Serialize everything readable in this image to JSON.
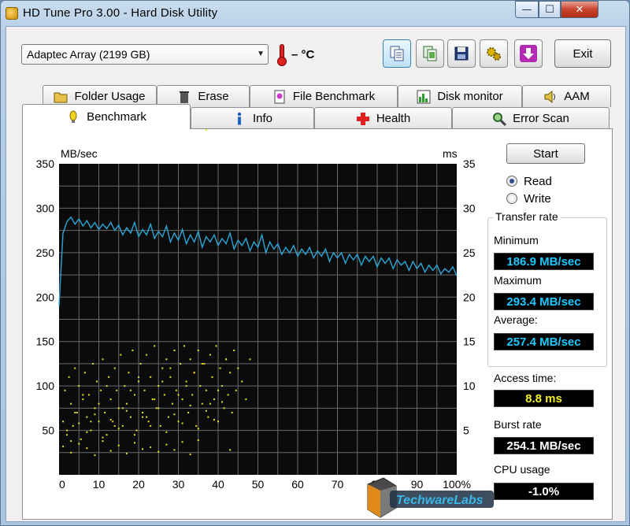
{
  "window": {
    "title": "HD Tune Pro 3.00 - Hard Disk Utility",
    "caption_buttons": {
      "minimize": "—",
      "maximize": "☐",
      "close": "✕"
    }
  },
  "toolbar": {
    "drive": "Adaptec Array (2199 GB)",
    "temperature": "– °C",
    "exit_label": "Exit"
  },
  "tabs_top": [
    "Folder Usage",
    "Erase",
    "File Benchmark",
    "Disk monitor",
    "AAM"
  ],
  "tabs_bottom": [
    "Benchmark",
    "Info",
    "Health",
    "Error Scan"
  ],
  "benchmark": {
    "start_label": "Start",
    "read_label": "Read",
    "write_label": "Write",
    "selected_mode": "Read",
    "transfer_rate_label": "Transfer rate",
    "minimum_label": "Minimum",
    "minimum_value": "186.9 MB/sec",
    "maximum_label": "Maximum",
    "maximum_value": "293.4 MB/sec",
    "average_label": "Average:",
    "average_value": "257.4 MB/sec",
    "access_time_label": "Access time:",
    "access_time_value": "8.8 ms",
    "burst_rate_label": "Burst rate",
    "burst_rate_value": "254.1 MB/sec",
    "cpu_usage_label": "CPU usage",
    "cpu_usage_value": "-1.0%"
  },
  "chart_data": {
    "type": "line",
    "left_axis_label": "MB/sec",
    "right_axis_label": "ms",
    "y_left_ticks": [
      50,
      100,
      150,
      200,
      250,
      300,
      350
    ],
    "y_right_ticks": [
      5,
      10,
      15,
      20,
      25,
      30,
      35
    ],
    "x_ticks": [
      "0",
      "10",
      "20",
      "30",
      "40",
      "50",
      "60",
      "70",
      "80",
      "90",
      "100%"
    ],
    "ylim_left": [
      0,
      350
    ],
    "ylim_right": [
      0,
      35
    ],
    "xlim": [
      0,
      100
    ],
    "grid": true,
    "series": [
      {
        "x": [
          0,
          0.5,
          1,
          2,
          3,
          4,
          5,
          6,
          7,
          8,
          9,
          10,
          11,
          12,
          13,
          14,
          15,
          16,
          17,
          18,
          19,
          20,
          21,
          22,
          23,
          24,
          25,
          26,
          27,
          28,
          29,
          30,
          31,
          32,
          33,
          34,
          35,
          36,
          37,
          38,
          39,
          40,
          41,
          42,
          43,
          44,
          45,
          46,
          47,
          48,
          49,
          50,
          51,
          52,
          53,
          54,
          55,
          56,
          57,
          58,
          59,
          60,
          61,
          62,
          63,
          64,
          65,
          66,
          67,
          68,
          69,
          70,
          71,
          72,
          73,
          74,
          75,
          76,
          77,
          78,
          79,
          80,
          81,
          82,
          83,
          84,
          85,
          86,
          87,
          88,
          89,
          90,
          91,
          92,
          93,
          94,
          95,
          96,
          97,
          98,
          99,
          100
        ],
        "y": [
          190,
          232,
          272,
          285,
          290,
          282,
          288,
          280,
          286,
          278,
          284,
          276,
          282,
          277,
          284,
          275,
          281,
          270,
          278,
          272,
          284,
          268,
          276,
          270,
          282,
          266,
          274,
          268,
          280,
          262,
          272,
          264,
          276,
          260,
          270,
          262,
          274,
          256,
          268,
          262,
          270,
          258,
          266,
          260,
          272,
          254,
          264,
          258,
          266,
          252,
          262,
          256,
          270,
          250,
          262,
          254,
          260,
          248,
          256,
          250,
          258,
          246,
          254,
          248,
          256,
          244,
          252,
          246,
          254,
          240,
          250,
          244,
          250,
          238,
          248,
          242,
          248,
          236,
          246,
          240,
          246,
          234,
          244,
          238,
          244,
          232,
          242,
          236,
          240,
          230,
          240,
          232,
          238,
          228,
          236,
          230,
          236,
          226,
          232,
          228,
          234,
          224
        ]
      }
    ],
    "scatter": {
      "x": [
        1,
        1.5,
        2,
        2.5,
        3,
        3.5,
        4,
        4.5,
        5,
        5.5,
        6,
        6.5,
        7,
        7.5,
        8,
        8.5,
        9,
        9.5,
        10,
        10.5,
        11,
        11.5,
        12,
        12.5,
        13,
        13.5,
        14,
        14.5,
        15,
        15.5,
        16,
        16.5,
        17,
        17.5,
        18,
        18.5,
        19,
        19.5,
        20,
        20.5,
        21,
        21.5,
        22,
        22.5,
        23,
        23.5,
        24,
        24.5,
        25,
        25.5,
        26,
        26.5,
        27,
        27.5,
        28,
        28.5,
        29,
        29.5,
        30,
        30.5,
        31,
        31.5,
        32,
        32.5,
        33,
        33.5,
        34,
        34.5,
        35,
        35.5,
        36,
        36.5,
        37,
        37.5,
        38,
        38.5,
        39,
        39.5,
        40,
        40.5,
        41,
        41.5,
        42,
        42.5,
        43,
        43.5,
        44,
        44.5,
        45,
        46,
        47,
        48,
        2,
        4,
        6,
        8,
        10,
        12,
        14,
        16,
        18,
        20,
        22,
        24,
        26,
        28,
        30,
        32,
        34,
        36,
        38,
        40,
        42,
        3,
        5,
        7,
        9,
        11,
        13,
        15,
        17,
        19,
        21,
        23,
        25,
        27,
        29,
        31,
        33,
        35,
        37,
        39,
        41,
        43,
        1,
        3,
        5,
        7,
        9,
        11,
        13,
        15,
        17,
        19,
        21,
        23,
        25,
        27,
        29,
        31,
        33,
        35,
        37
      ],
      "y": [
        60,
        95,
        45,
        110,
        80,
        55,
        120,
        70,
        100,
        40,
        85,
        115,
        65,
        90,
        50,
        125,
        75,
        105,
        60,
        95,
        130,
        70,
        45,
        110,
        85,
        60,
        120,
        95,
        75,
        135,
        55,
        100,
        80,
        115,
        65,
        140,
        90,
        50,
        105,
        125,
        70,
        95,
        135,
        60,
        110,
        85,
        145,
        75,
        100,
        55,
        120,
        90,
        130,
        65,
        110,
        80,
        140,
        95,
        60,
        125,
        85,
        145,
        105,
        70,
        130,
        90,
        115,
        55,
        140,
        100,
        80,
        125,
        95,
        65,
        135,
        110,
        85,
        145,
        60,
        120,
        100,
        75,
        130,
        90,
        115,
        70,
        140,
        95,
        120,
        105,
        85,
        130,
        50,
        70,
        90,
        60,
        80,
        100,
        55,
        75,
        95,
        110,
        65,
        85,
        105,
        120,
        90,
        100,
        115,
        125,
        80,
        95,
        130,
        38,
        58,
        48,
        68,
        42,
        62,
        52,
        72,
        45,
        65,
        55,
        75,
        48,
        68,
        58,
        78,
        52,
        72,
        62,
        82,
        28,
        32,
        25,
        35,
        30,
        22,
        38,
        27,
        33,
        24,
        36,
        29,
        31,
        26,
        34,
        28,
        37,
        23,
        39
      ]
    }
  }
}
